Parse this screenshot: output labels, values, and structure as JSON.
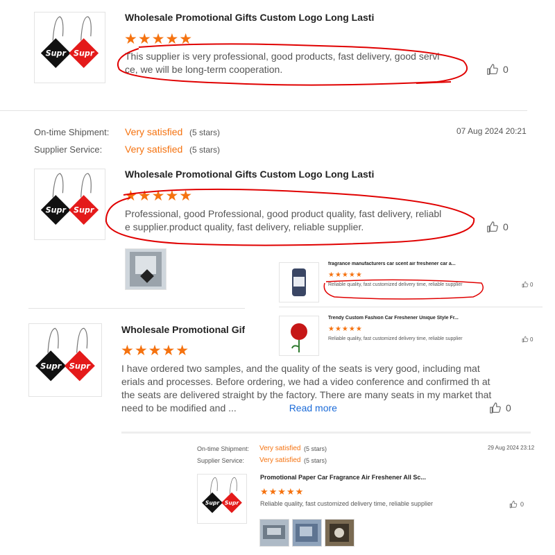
{
  "review1": {
    "product_title": "Wholesale Promotional Gifts Custom Logo Long Lasti...",
    "stars": "★★★★★",
    "text": "This supplier is very professional, good products, fast delivery, good servi ce, we will be long-term cooperation.",
    "likes": "0"
  },
  "review2": {
    "shipment_label": "On-time Shipment:",
    "shipment_value": "Very satisfied",
    "shipment_count": "(5 stars)",
    "service_label": "Supplier Service:",
    "service_value": "Very satisfied",
    "service_count": "(5 stars)",
    "date": "07 Aug 2024 20:21",
    "product_title": "Wholesale Promotional Gifts Custom Logo Long Lasti...",
    "stars": "★★★★★",
    "text": "Professional, good Professional, good product quality, fast delivery, reliabl e supplier.product quality, fast delivery, reliable supplier.",
    "likes": "0"
  },
  "side_reviews": [
    {
      "title": "fragrance manufacturers car scent air freshener car a...",
      "stars": "★★★★★",
      "text": "Reliable quality, fast customized delivery time, reliable supplier",
      "likes": "0"
    },
    {
      "title": "Trendy Custom Fashion Car Freshener Unique Style Fr...",
      "stars": "★★★★★",
      "text": "Reliable quality, fast customized delivery time, reliable supplier",
      "likes": "0"
    }
  ],
  "review3": {
    "product_title": "Wholesale Promotional Gifts",
    "stars": "★★★★★",
    "text": "I have ordered two samples, and the quality of the seats is very good, including mat erials and processes. Before ordering, we had a video conference and confirmed th at the seats are delivered straight by the factory. There are many seats in my market that need to be modified and ...",
    "read_more": "Read more",
    "likes": "0"
  },
  "review4": {
    "shipment_label": "On-time Shipment:",
    "shipment_value": "Very satisfied",
    "shipment_count": "(5 stars)",
    "service_label": "Supplier Service:",
    "service_value": "Very satisfied",
    "service_count": "(5 stars)",
    "date": "29 Aug 2024 23:12",
    "product_title": "Promotional Paper Car Fragrance Air Freshener All Sc...",
    "stars": "★★★★★",
    "text": "Reliable quality, fast customized delivery time, reliable supplier",
    "likes": "0"
  },
  "logo_text": "Supr",
  "colors": {
    "accent": "#f5720f",
    "annotation": "#e00000",
    "link": "#1a6ad8"
  }
}
